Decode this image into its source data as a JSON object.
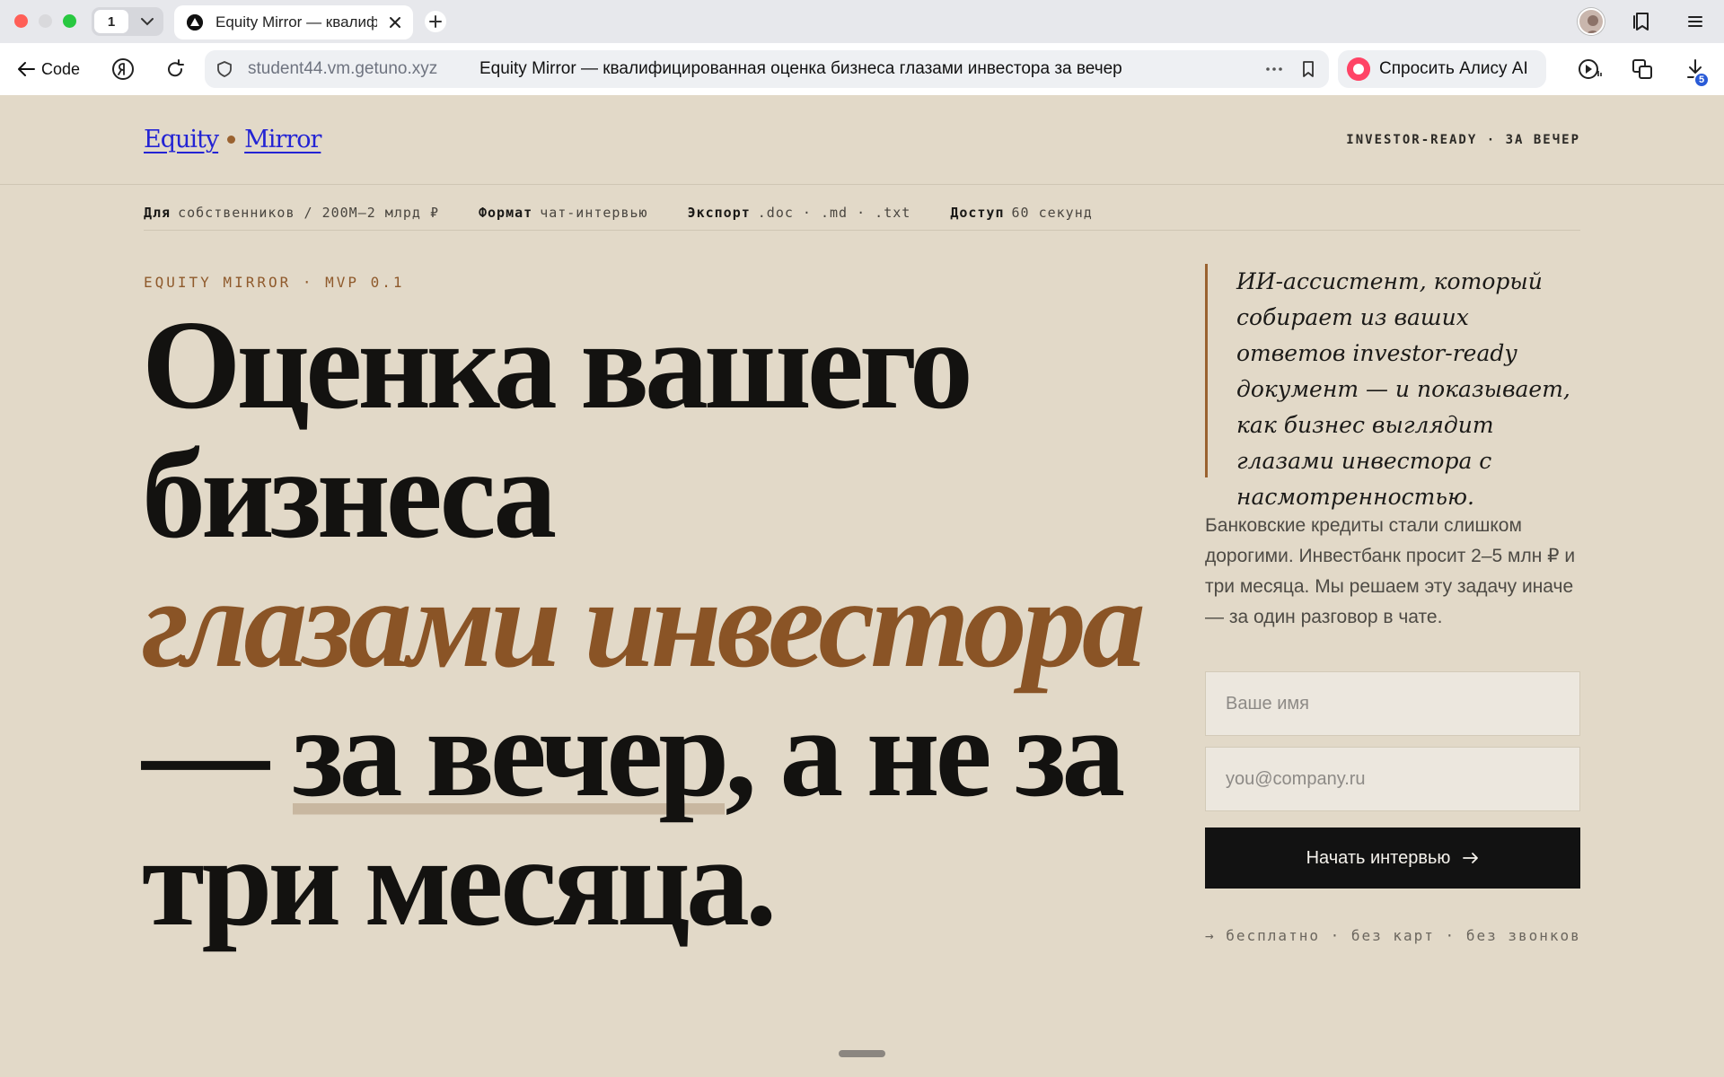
{
  "browser": {
    "tab_count": "1",
    "active_tab_title": "Equity Mirror — квалифицированная оценка бизнеса глазами инвестора за вечер",
    "back_label": "Code",
    "url_host": "student44.vm.getuno.xyz",
    "page_title": "Equity Mirror — квалифицированная оценка бизнеса глазами инвестора за вечер",
    "alice_label": "Спросить Алису AI",
    "downloads_badge": "5"
  },
  "site": {
    "brand_left": "Equity",
    "brand_right": "Mirror",
    "top_tag": "INVESTOR-READY · ЗА ВЕЧЕР",
    "meta": [
      {
        "key": "Для",
        "value": "собственников / 200М–2 млрд ₽"
      },
      {
        "key": "Формат",
        "value": "чат-интервью"
      },
      {
        "key": "Экспорт",
        "value": ".doc · .md · .txt"
      },
      {
        "key": "Доступ",
        "value": "60 секунд"
      }
    ],
    "kicker": "EQUITY MIRROR · MVP 0.1",
    "headline": {
      "line1": "Оценка вашего",
      "line2": "бизнеса",
      "line3_accent": "глазами инвестора",
      "line4_dash": "— ",
      "line4_highlight": "за вечер",
      "line4_rest": ", а не за",
      "line5": "три месяца."
    },
    "quote": "ИИ-ассистент, который собирает из ваших ответов investor-ready документ — и показывает, как бизнес выглядит глазами инвестора с насмотренностью.",
    "lead": "Банковские кредиты стали слишком дорогими. Инвестбанк просит 2–5 млн ₽ и три месяца. Мы решаем эту задачу иначе — за один разговор в чате.",
    "form": {
      "name_placeholder": "Ваше имя",
      "email_placeholder": "you@company.ru",
      "submit_label": "Начать интервью"
    },
    "fineprint": "→ бесплатно · без карт · без звонков"
  },
  "colors": {
    "page_bg": "#e2d9c8",
    "accent_brown": "#8a5426",
    "brand_blue": "#2323d4",
    "button_bg": "#121212"
  },
  "icons": [
    "back-arrow-icon",
    "yandex-icon",
    "reload-icon",
    "shield-icon",
    "more-icon",
    "bookmark-icon",
    "alice-icon",
    "player-icon",
    "translate-icon",
    "download-icon",
    "collections-icon",
    "menu-icon",
    "plus-icon",
    "close-icon",
    "chevron-down-icon",
    "arrow-right-icon"
  ]
}
